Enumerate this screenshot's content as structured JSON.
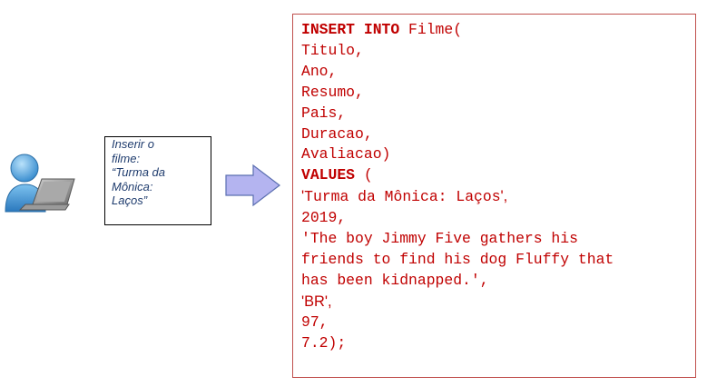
{
  "note": {
    "lines": [
      "Inserir o",
      "filme:",
      "“Turma da",
      "Mônica:",
      "Laços”"
    ]
  },
  "sql": {
    "insert_keyword": "INSERT INTO",
    "table": " Filme(",
    "columns": [
      "Titulo,",
      "Ano,",
      "Resumo,",
      "Pais,",
      "Duracao,",
      "Avaliacao)"
    ],
    "values_keyword": "VALUES",
    "values_open": " (",
    "title_prefix": "'",
    "title_value": "Turma da Mônica: Laços",
    "title_suffix": "',",
    "year": "2019,",
    "summary_lines": [
      "'The boy Jimmy Five gathers his",
      "friends to find his dog Fluffy that",
      "has been kidnapped.',"
    ],
    "country_value": "'BR',",
    "duration": "97,",
    "rating": "7.2);"
  },
  "colors": {
    "code": "#c00000",
    "code_border": "#c0504d",
    "note_text": "#1f3c6e",
    "arrow_fill": "#b4b4f0",
    "arrow_stroke": "#5b6fb0",
    "user_head": "#5aa6dc",
    "laptop": "#8a8a8a"
  }
}
